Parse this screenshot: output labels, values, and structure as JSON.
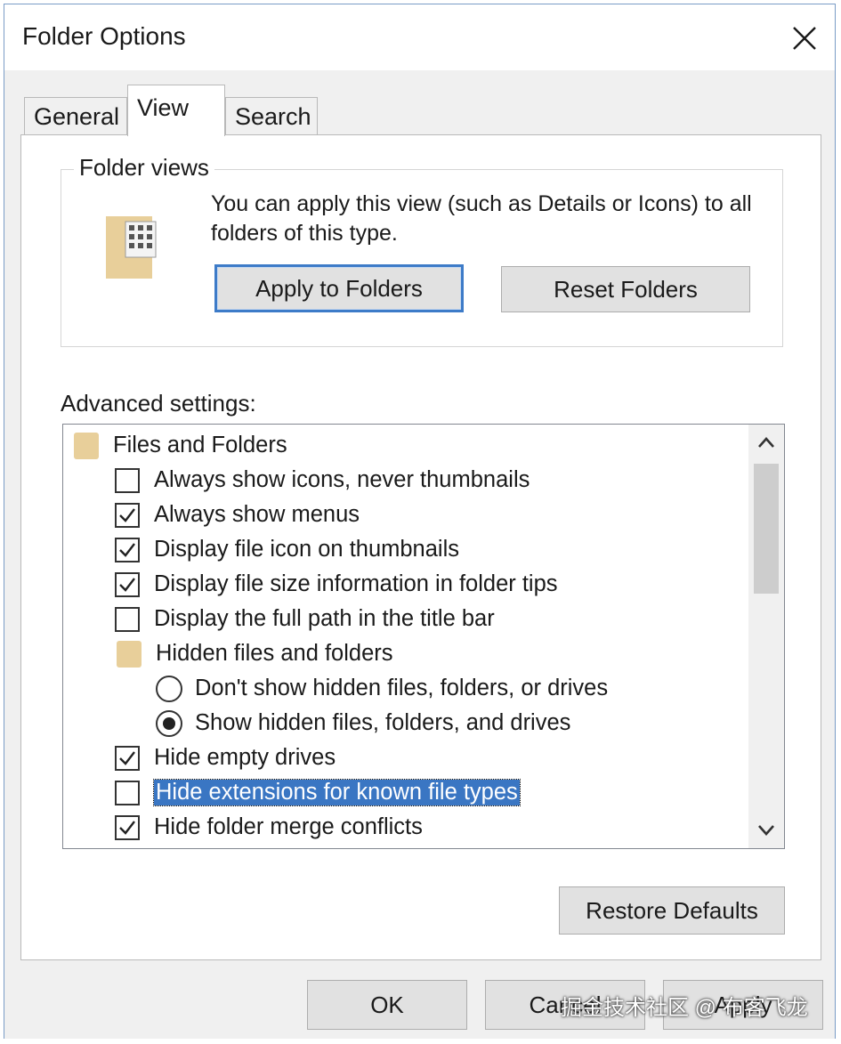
{
  "window": {
    "title": "Folder Options"
  },
  "tabs": [
    {
      "label": "General",
      "active": false
    },
    {
      "label": "View",
      "active": true
    },
    {
      "label": "Search",
      "active": false
    }
  ],
  "folder_views": {
    "legend": "Folder views",
    "description": "You can apply this view (such as Details or Icons) to all folders of this type.",
    "apply_button": "Apply to Folders",
    "reset_button": "Reset Folders"
  },
  "advanced": {
    "label": "Advanced settings:",
    "items": [
      {
        "type": "folder",
        "label": "Files and Folders"
      },
      {
        "type": "checkbox",
        "label": "Always show icons, never thumbnails",
        "checked": false
      },
      {
        "type": "checkbox",
        "label": "Always show menus",
        "checked": true
      },
      {
        "type": "checkbox",
        "label": "Display file icon on thumbnails",
        "checked": true
      },
      {
        "type": "checkbox",
        "label": "Display file size information in folder tips",
        "checked": true
      },
      {
        "type": "checkbox",
        "label": "Display the full path in the title bar",
        "checked": false
      },
      {
        "type": "folder",
        "label": "Hidden files and folders"
      },
      {
        "type": "radio",
        "label": "Don't show hidden files, folders, or drives",
        "checked": false
      },
      {
        "type": "radio",
        "label": "Show hidden files, folders, and drives",
        "checked": true
      },
      {
        "type": "checkbox",
        "label": "Hide empty drives",
        "checked": true
      },
      {
        "type": "checkbox",
        "label": "Hide extensions for known file types",
        "checked": false,
        "selected": true
      },
      {
        "type": "checkbox",
        "label": "Hide folder merge conflicts",
        "checked": true
      }
    ]
  },
  "restore_button": "Restore Defaults",
  "footer": {
    "ok": "OK",
    "cancel": "Cancel",
    "apply": "Apply"
  },
  "watermark": "掘金技术社区 @ 布客飞龙",
  "colors": {
    "selection": "#3a76c3",
    "focus_border": "#3d7bc8",
    "folder": "#e8cf9a"
  }
}
